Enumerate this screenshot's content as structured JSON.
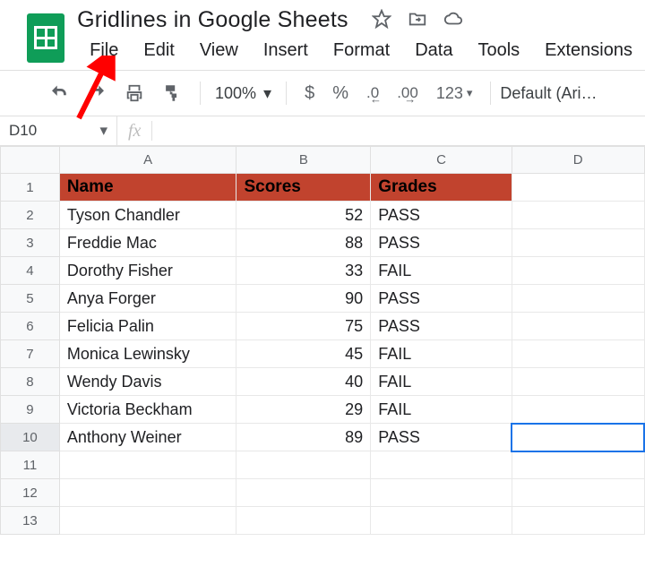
{
  "doc": {
    "title": "Gridlines in Google Sheets"
  },
  "menu": {
    "file": "File",
    "edit": "Edit",
    "view": "View",
    "insert": "Insert",
    "format": "Format",
    "data": "Data",
    "tools": "Tools",
    "extensions": "Extensions"
  },
  "toolbar": {
    "zoom": "100%",
    "currency": "$",
    "percent": "%",
    "dec_dec": ".0",
    "dec_inc": ".00",
    "num_fmt": "123",
    "font": "Default (Ari…"
  },
  "namebox": "D10",
  "columns": [
    "A",
    "B",
    "C",
    "D"
  ],
  "header": {
    "name": "Name",
    "scores": "Scores",
    "grades": "Grades"
  },
  "rows": [
    {
      "n": "1"
    },
    {
      "n": "2",
      "name": "Tyson Chandler",
      "score": "52",
      "grade": "PASS"
    },
    {
      "n": "3",
      "name": "Freddie Mac",
      "score": "88",
      "grade": "PASS"
    },
    {
      "n": "4",
      "name": "Dorothy Fisher",
      "score": "33",
      "grade": " FAIL"
    },
    {
      "n": "5",
      "name": "Anya Forger",
      "score": "90",
      "grade": "PASS"
    },
    {
      "n": "6",
      "name": "Felicia Palin",
      "score": "75",
      "grade": "PASS"
    },
    {
      "n": "7",
      "name": "Monica Lewinsky",
      "score": "45",
      "grade": "FAIL"
    },
    {
      "n": "8",
      "name": "Wendy Davis",
      "score": "40",
      "grade": "FAIL"
    },
    {
      "n": "9",
      "name": "Victoria Beckham",
      "score": "29",
      "grade": "FAIL"
    },
    {
      "n": "10",
      "name": "Anthony Weiner",
      "score": "89",
      "grade": "PASS"
    },
    {
      "n": "11"
    },
    {
      "n": "12"
    },
    {
      "n": "13"
    }
  ],
  "selected_cell": "D10"
}
